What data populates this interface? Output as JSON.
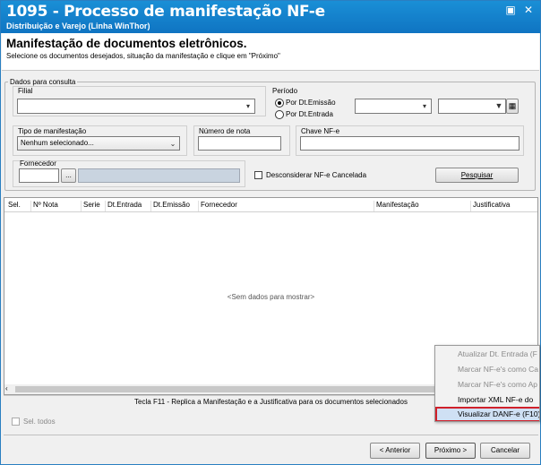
{
  "window": {
    "title": "1095 - Processo de manifestação NF-e",
    "subtitle": "Distribuição e Varejo (Linha WinThor)",
    "controls": [
      "▣",
      "✕"
    ]
  },
  "header": {
    "title": "Manifestação de documentos eletrônicos.",
    "instruction": "Selecione os documentos desejados, situação da manifestação e clique em \"Próximo\""
  },
  "query": {
    "group_label": "Dados para consulta",
    "filial_label": "Filial",
    "periodo_label": "Período",
    "radio_emissao": "Por Dt.Emissão",
    "radio_entrada": "Por Dt.Entrada",
    "tipo_label": "Tipo de manifestação",
    "tipo_value": "Nenhum selecionado...",
    "numero_label": "Número de nota",
    "chave_label": "Chave NF-e",
    "fornecedor_label": "Fornecedor",
    "fornecedor_btn": "...",
    "desconsiderar_label": "Desconsiderar NF-e Cancelada",
    "pesquisar_btn": "Pesquisar"
  },
  "grid": {
    "columns": [
      "Sel.",
      "Nº Nota",
      "Serie",
      "Dt.Entrada",
      "Dt.Emissão",
      "Fornecedor",
      "Manifestação",
      "Justificativa"
    ],
    "empty_text": "<Sem dados para mostrar>"
  },
  "hint": "Tecla F11 - Replica a Manifestação e a Justificativa para os documentos selecionados",
  "sel_todos": "Sel. todos",
  "context_menu": {
    "items": [
      {
        "label": "Atualizar Dt. Entrada (F",
        "enabled": false
      },
      {
        "label": "Marcar NF-e's como Ca",
        "enabled": false
      },
      {
        "label": "Marcar NF-e's como Ap",
        "enabled": false
      },
      {
        "label": "Importar XML NF-e do",
        "enabled": true
      },
      {
        "label": "Visualizar DANF-e (F10)",
        "enabled": true,
        "highlighted": true
      }
    ]
  },
  "footer": {
    "anterior": "< Anterior",
    "proximo": "Próximo >",
    "cancelar": "Cancelar"
  },
  "colors": {
    "titlebar": "#0f74c2",
    "highlight_border": "#d0202a"
  }
}
